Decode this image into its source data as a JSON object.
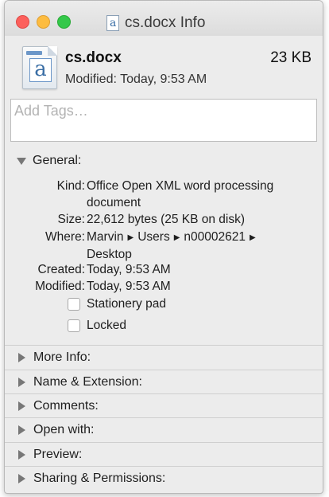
{
  "window": {
    "title": "cs.docx Info"
  },
  "header": {
    "file_name": "cs.docx",
    "file_size": "23 KB",
    "modified": "Modified: Today, 9:53 AM",
    "icon": "word-document-icon"
  },
  "tags": {
    "placeholder": "Add Tags…"
  },
  "general": {
    "title": "General:",
    "expanded": true,
    "rows": {
      "kind": {
        "label": "Kind:",
        "value": "Office Open XML word processing document"
      },
      "size": {
        "label": "Size:",
        "value": "22,612 bytes (25 KB on disk)"
      },
      "where": {
        "label": "Where:",
        "path": [
          "Marvin",
          "Users",
          "n00002621",
          "Desktop"
        ],
        "separator_icon": "path-arrow-icon"
      },
      "created": {
        "label": "Created:",
        "value": "Today, 9:53 AM"
      },
      "modified": {
        "label": "Modified:",
        "value": "Today, 9:53 AM"
      }
    },
    "stationery_pad": {
      "label": "Stationery pad",
      "checked": false
    },
    "locked": {
      "label": "Locked",
      "checked": false
    }
  },
  "sections": [
    {
      "title": "More Info:",
      "expanded": false
    },
    {
      "title": "Name & Extension:",
      "expanded": false
    },
    {
      "title": "Comments:",
      "expanded": false
    },
    {
      "title": "Open with:",
      "expanded": false
    },
    {
      "title": "Preview:",
      "expanded": false
    },
    {
      "title": "Sharing & Permissions:",
      "expanded": false
    }
  ],
  "colors": {
    "close": "#fc605c",
    "minimize": "#fdbc40",
    "zoom": "#34c84a",
    "window_bg": "#ececec"
  }
}
